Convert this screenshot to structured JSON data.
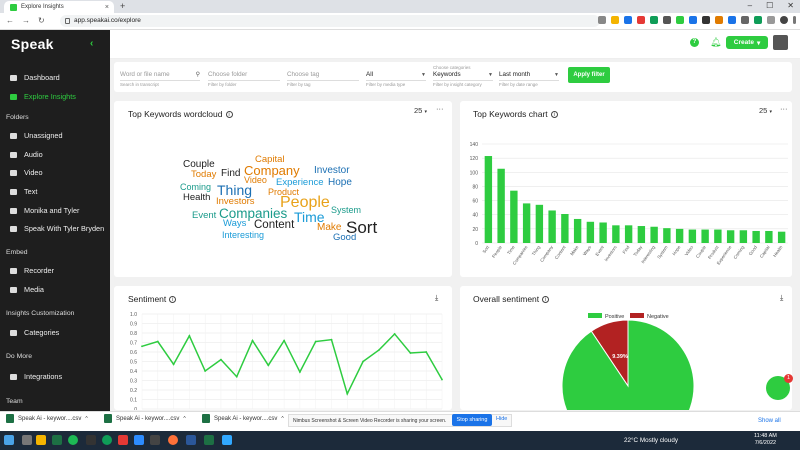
{
  "browser": {
    "tab_title": "Explore Insights",
    "url": "app.speakai.co/explore"
  },
  "app": {
    "logo": "Speak",
    "sidebar": {
      "main_items": [
        {
          "label": "Dashboard",
          "icon": "dashboard-icon"
        },
        {
          "label": "Explore Insights",
          "icon": "insights-icon",
          "active": true
        }
      ],
      "folders_heading": "Folders",
      "folders": [
        "Unassigned",
        "Audio",
        "Video",
        "Text",
        "Monika and Tyler",
        "Speak With Tyler Bryden"
      ],
      "embed_heading": "Embed",
      "embed_items": [
        "Recorder",
        "Media"
      ],
      "insights_heading": "Insights Customization",
      "insights_items": [
        "Categories"
      ],
      "domore_heading": "Do More",
      "domore_items": [
        "Integrations"
      ],
      "team_heading": "Team"
    },
    "header": {
      "create_label": "Create"
    },
    "filters": {
      "search": {
        "placeholder": "Word or file name",
        "sub": "Search in transcript"
      },
      "folder": {
        "placeholder": "Choose folder",
        "sub": "Filter by folder"
      },
      "tag": {
        "placeholder": "Choose tag",
        "sub": "Filter by tag"
      },
      "media_type": {
        "value": "All",
        "sub": "Filter by media type"
      },
      "category": {
        "top": "Choose categories",
        "value": "Keywords",
        "sub": "Filter by insight category"
      },
      "date": {
        "value": "Last month",
        "sub": "Filter by date range"
      },
      "apply_label": "Apply filter"
    },
    "wordcloud": {
      "title": "Top Keywords wordcloud",
      "count": "25",
      "words": [
        {
          "text": "Couple",
          "color": "#222222"
        },
        {
          "text": "Capital",
          "color": "#e07b00"
        },
        {
          "text": "Find",
          "color": "#222222"
        },
        {
          "text": "Company",
          "color": "#e07b00"
        },
        {
          "text": "Investor",
          "color": "#1b6fb3"
        },
        {
          "text": "Today",
          "color": "#e07b00"
        },
        {
          "text": "Video",
          "color": "#e07b00"
        },
        {
          "text": "Experience",
          "color": "#1b9bd7"
        },
        {
          "text": "Hope",
          "color": "#1b6fb3"
        },
        {
          "text": "Coming",
          "color": "#1b9b8b"
        },
        {
          "text": "Thing",
          "color": "#1b6fb3"
        },
        {
          "text": "Product",
          "color": "#e07b00"
        },
        {
          "text": "Health",
          "color": "#222222"
        },
        {
          "text": "Investors",
          "color": "#e07b00"
        },
        {
          "text": "People",
          "color": "#e8a21a"
        },
        {
          "text": "System",
          "color": "#1b9b8b"
        },
        {
          "text": "Event",
          "color": "#1b9b8b"
        },
        {
          "text": "Companies",
          "color": "#1b9b8b"
        },
        {
          "text": "Time",
          "color": "#1b9bd7"
        },
        {
          "text": "Ways",
          "color": "#1b9bd7"
        },
        {
          "text": "Content",
          "color": "#222222"
        },
        {
          "text": "Make",
          "color": "#e07b00"
        },
        {
          "text": "Sort",
          "color": "#222222"
        },
        {
          "text": "Interesting",
          "color": "#1b9bd7"
        },
        {
          "text": "Good",
          "color": "#1b6fb3"
        }
      ]
    },
    "keywords_chart": {
      "title": "Top Keywords chart",
      "count": "25"
    },
    "sentiment": {
      "title": "Sentiment"
    },
    "overall_sentiment": {
      "title": "Overall sentiment"
    },
    "chart_data": [
      {
        "type": "bar",
        "categories": [
          "Sort",
          "People",
          "Time",
          "Companies",
          "Thing",
          "Company",
          "Content",
          "Make",
          "Ways",
          "Event",
          "Investors",
          "Find",
          "Today",
          "Interesting",
          "System",
          "Hope",
          "Video",
          "Couple",
          "Product",
          "Experience",
          "Coming",
          "Good",
          "Capital",
          "Health"
        ],
        "values": [
          123,
          105,
          74,
          56,
          54,
          46,
          41,
          34,
          30,
          29,
          25,
          25,
          24,
          23,
          21,
          20,
          19,
          19,
          19,
          18,
          18,
          17,
          17,
          16
        ],
        "ylim": [
          0,
          140
        ],
        "yticks": [
          "0",
          "20",
          "40",
          "60",
          "80",
          "100",
          "120",
          "140"
        ],
        "color": "#2ecc40"
      },
      {
        "type": "line",
        "values": [
          0.66,
          0.71,
          0.47,
          0.77,
          0.4,
          0.52,
          0.34,
          0.72,
          0.46,
          0.72,
          0.39,
          0.71,
          0.73,
          0.16,
          0.5,
          0.62,
          0.79,
          0.59,
          0.6,
          0.31
        ],
        "ylim": [
          0,
          1.0
        ],
        "yticks": [
          "0",
          "0.1",
          "0.2",
          "0.3",
          "0.4",
          "0.5",
          "0.6",
          "0.7",
          "0.8",
          "0.9",
          "1.0"
        ],
        "color": "#2ecc40"
      },
      {
        "type": "pie",
        "legend": [
          "Positive",
          "Negative"
        ],
        "values": [
          90.61,
          9.39
        ],
        "colors": [
          "#2ecc40",
          "#b22222"
        ],
        "label": "9.39%"
      }
    ],
    "share_bar": {
      "downloads": [
        "Speak Ai - keywor....csv",
        "Speak Ai - keywor....csv",
        "Speak Ai - keywor....csv"
      ],
      "message": "Nimbus Screenshot & Screen Video Recorder is sharing your screen.",
      "stop_label": "Stop sharing",
      "hide_label": "Hide",
      "show_all_label": "Show all"
    },
    "taskbar": {
      "weather": "22°C  Mostly cloudy",
      "time": "11:48 AM",
      "date": "7/6/2022"
    },
    "chat_badge": "1"
  }
}
